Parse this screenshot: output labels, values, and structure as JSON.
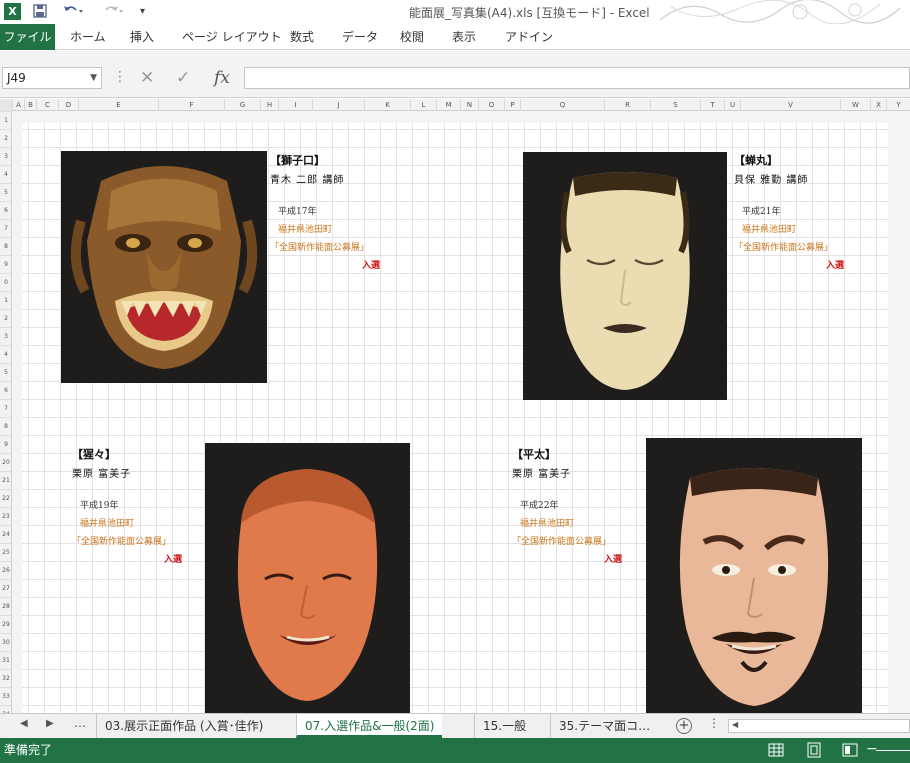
{
  "app": {
    "window_title": "能面展_写真集(A4).xls  [互換モード] - Excel",
    "logo": "X",
    "qat": {
      "save_icon": "save-icon",
      "undo_icon": "undo-icon",
      "redo_icon": "redo-icon",
      "customize": "▾"
    }
  },
  "ribbon": {
    "file": "ファイル",
    "tabs": [
      "ホーム",
      "挿入",
      "ページ レイアウト",
      "数式",
      "データ",
      "校閲",
      "表示",
      "アドイン"
    ]
  },
  "formula_bar": {
    "name_box": "J49",
    "cancel": "✕",
    "enter": "✓",
    "fx": "fx",
    "value": ""
  },
  "columns": [
    "A",
    "B",
    "C",
    "D",
    "E",
    "F",
    "G",
    "H",
    "I",
    "J",
    "K",
    "L",
    "M",
    "N",
    "O",
    "P",
    "Q",
    "R",
    "S",
    "T",
    "U",
    "V",
    "W",
    "X",
    "Y"
  ],
  "rows": [
    "1",
    "2",
    "3",
    "4",
    "5",
    "6",
    "7",
    "8",
    "9",
    "0",
    "1",
    "2",
    "3",
    "4",
    "5",
    "6",
    "7",
    "8",
    "9",
    "20",
    "21",
    "22",
    "23",
    "24",
    "25",
    "26",
    "27",
    "28",
    "29",
    "30",
    "31",
    "32",
    "33",
    "34"
  ],
  "masks": [
    {
      "name": "【獅子口】",
      "carver": "青木 二郎 講師",
      "year": "平成17年",
      "place": "福井県池田町",
      "contest": "「全国新作能面公募展」",
      "award": "入選"
    },
    {
      "name": "【蝉丸】",
      "carver": "貝保 雅勤 講師",
      "year": "平成21年",
      "place": "福井県池田町",
      "contest": "「全国新作能面公募展」",
      "award": "入選"
    },
    {
      "name": "【猩々】",
      "carver": "栗原 富美子",
      "year": "平成19年",
      "place": "福井県池田町",
      "contest": "「全国新作能面公募展」",
      "award": "入選"
    },
    {
      "name": "【平太】",
      "carver": "栗原 富美子",
      "year": "平成22年",
      "place": "福井県池田町",
      "contest": "「全国新作能面公募展」",
      "award": "入選"
    }
  ],
  "sheet_tabs": {
    "prev": "◀",
    "next": "▶",
    "more": "…",
    "tabs": [
      "03.展示正面作品 (入賞･佳作)",
      "07.入選作品&一般(2面)",
      "15.一般",
      "35.テーマ面コ…"
    ],
    "active_index": 1,
    "add": "+"
  },
  "status": {
    "text": "準備完了",
    "zoom_minus": "−"
  },
  "colors": {
    "accent": "#217346",
    "caption_orange": "#c8761f",
    "award_red": "#cc1111"
  }
}
